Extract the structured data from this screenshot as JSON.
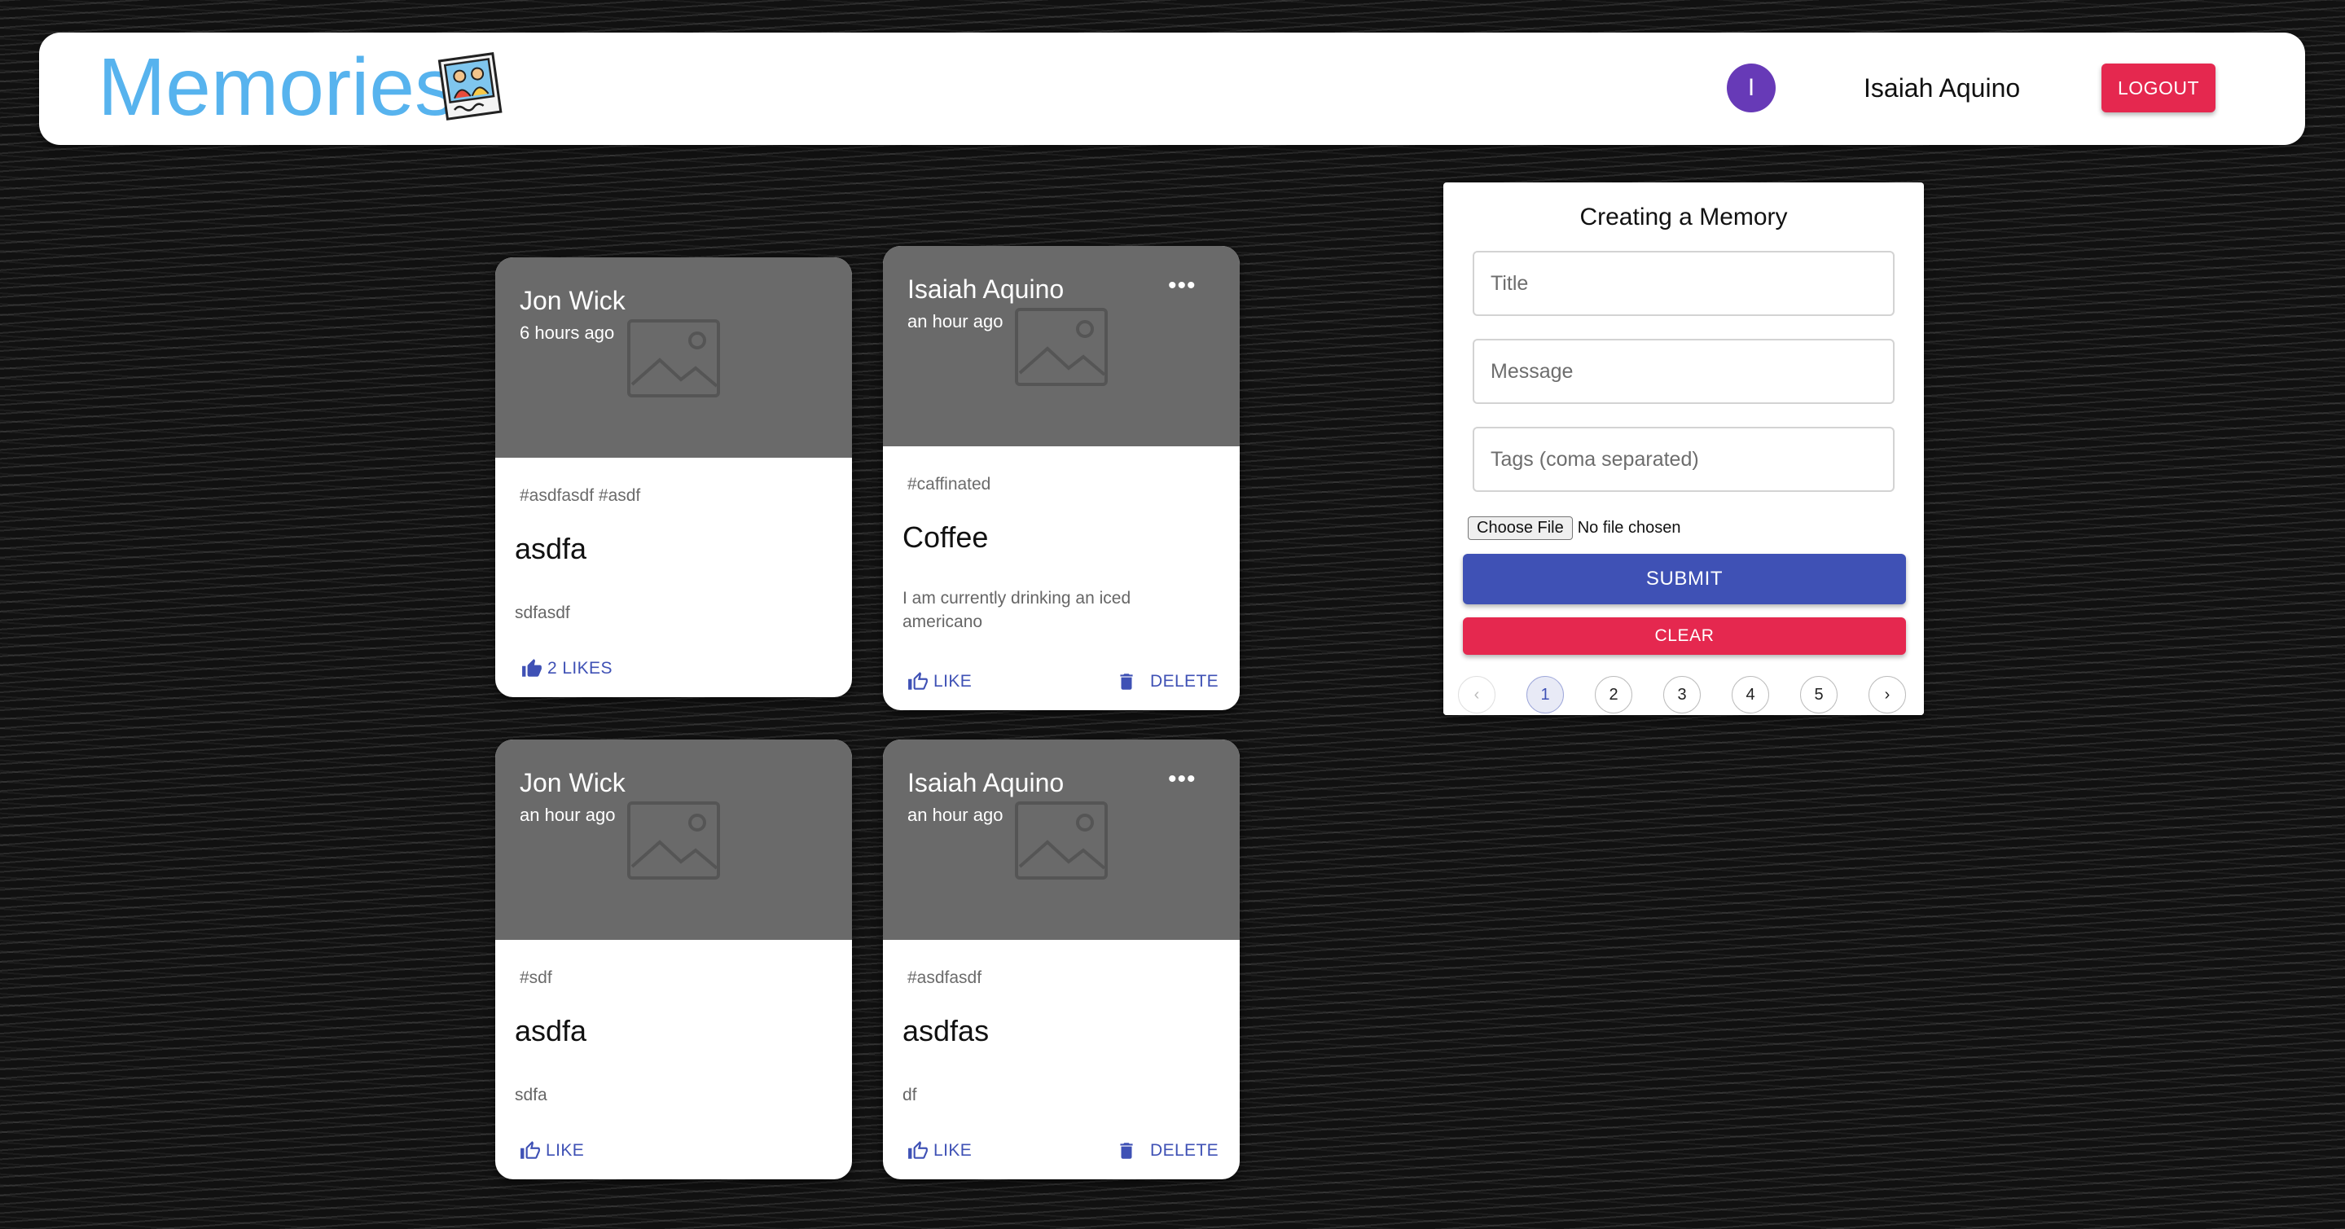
{
  "header": {
    "brand": "Memories",
    "brand_icon": "photo-icon",
    "avatar_initial": "I",
    "username": "Isaiah Aquino",
    "logout_label": "LOGOUT"
  },
  "posts": [
    {
      "author": "Jon Wick",
      "time": "6 hours ago",
      "tags": "#asdfasdf #asdf",
      "title": "asdfa",
      "message": "sdfasdf",
      "like_label": "2 LIKES"
    },
    {
      "author": "Isaiah Aquino",
      "time": "an hour ago",
      "tags": "#caffinated",
      "title": "Coffee",
      "message": "I am currently drinking an iced americano",
      "like_label": "LIKE",
      "delete_label": "DELETE",
      "more_label": "•••"
    },
    {
      "author": "Jon Wick",
      "time": "an hour ago",
      "tags": "#sdf",
      "title": "asdfa",
      "message": "sdfa",
      "like_label": "LIKE"
    },
    {
      "author": "Isaiah Aquino",
      "time": "an hour ago",
      "tags": "#asdfasdf",
      "title": "asdfas",
      "message": "df",
      "like_label": "LIKE",
      "delete_label": "DELETE",
      "more_label": "•••"
    }
  ],
  "form": {
    "title": "Creating a Memory",
    "title_placeholder": "Title",
    "message_placeholder": "Message",
    "tags_placeholder": "Tags (coma separated)",
    "file_button": "Choose File",
    "file_status": "No file chosen",
    "submit_label": "SUBMIT",
    "clear_label": "CLEAR"
  },
  "pagination": {
    "prev": "‹",
    "pages": [
      "1",
      "2",
      "3",
      "4",
      "5"
    ],
    "current": "1",
    "next": "›"
  },
  "colors": {
    "brand": "#57b3ee",
    "accent": "#3f51b5",
    "danger": "#e5284f",
    "avatar": "#673ab7",
    "card_media": "#6a6a6a"
  }
}
